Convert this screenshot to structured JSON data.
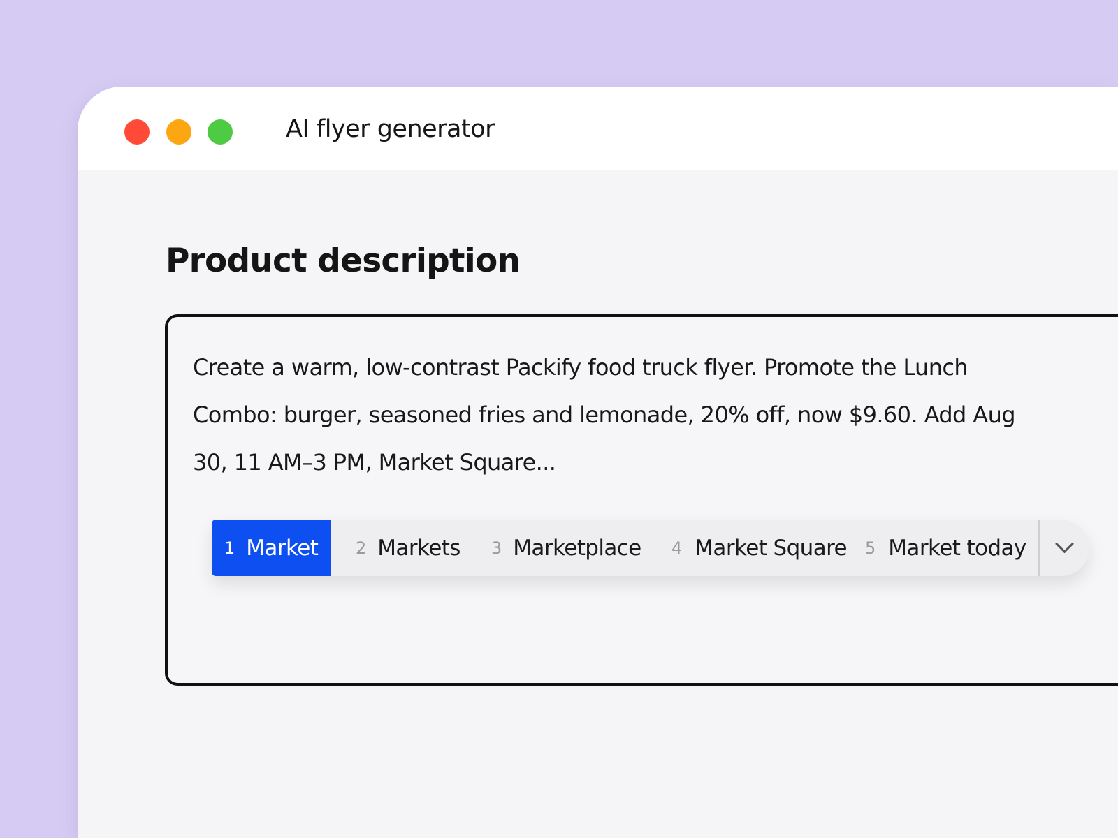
{
  "window": {
    "title": "AI flyer generator",
    "traffic_lights": [
      {
        "name": "close",
        "color": "#fe4a36"
      },
      {
        "name": "minimize",
        "color": "#fca712"
      },
      {
        "name": "maximize",
        "color": "#4ecb43"
      }
    ]
  },
  "main": {
    "heading": "Product description",
    "description": {
      "text": "Create a warm, low-contrast Packify food truck flyer. Promote the Lunch Combo: burger, seasoned fries and lemonade, 20% off, now $9.60. Add Aug 30, 11 AM–3 PM, Market Square..."
    },
    "suggestions": {
      "items": [
        {
          "number": "1",
          "label": "Market",
          "selected": true
        },
        {
          "number": "2",
          "label": "Markets",
          "selected": false
        },
        {
          "number": "3",
          "label": "Marketplace",
          "selected": false
        },
        {
          "number": "4",
          "label": "Market Square",
          "selected": false
        },
        {
          "number": "5",
          "label": "Market today",
          "selected": false
        }
      ],
      "expand_icon": "chevron-down-icon",
      "accent_color": "#0e4ff1"
    }
  },
  "colors": {
    "page_background": "#d6ccf3",
    "window_background": "#f5f5f7",
    "titlebar_background": "#ffffff"
  }
}
